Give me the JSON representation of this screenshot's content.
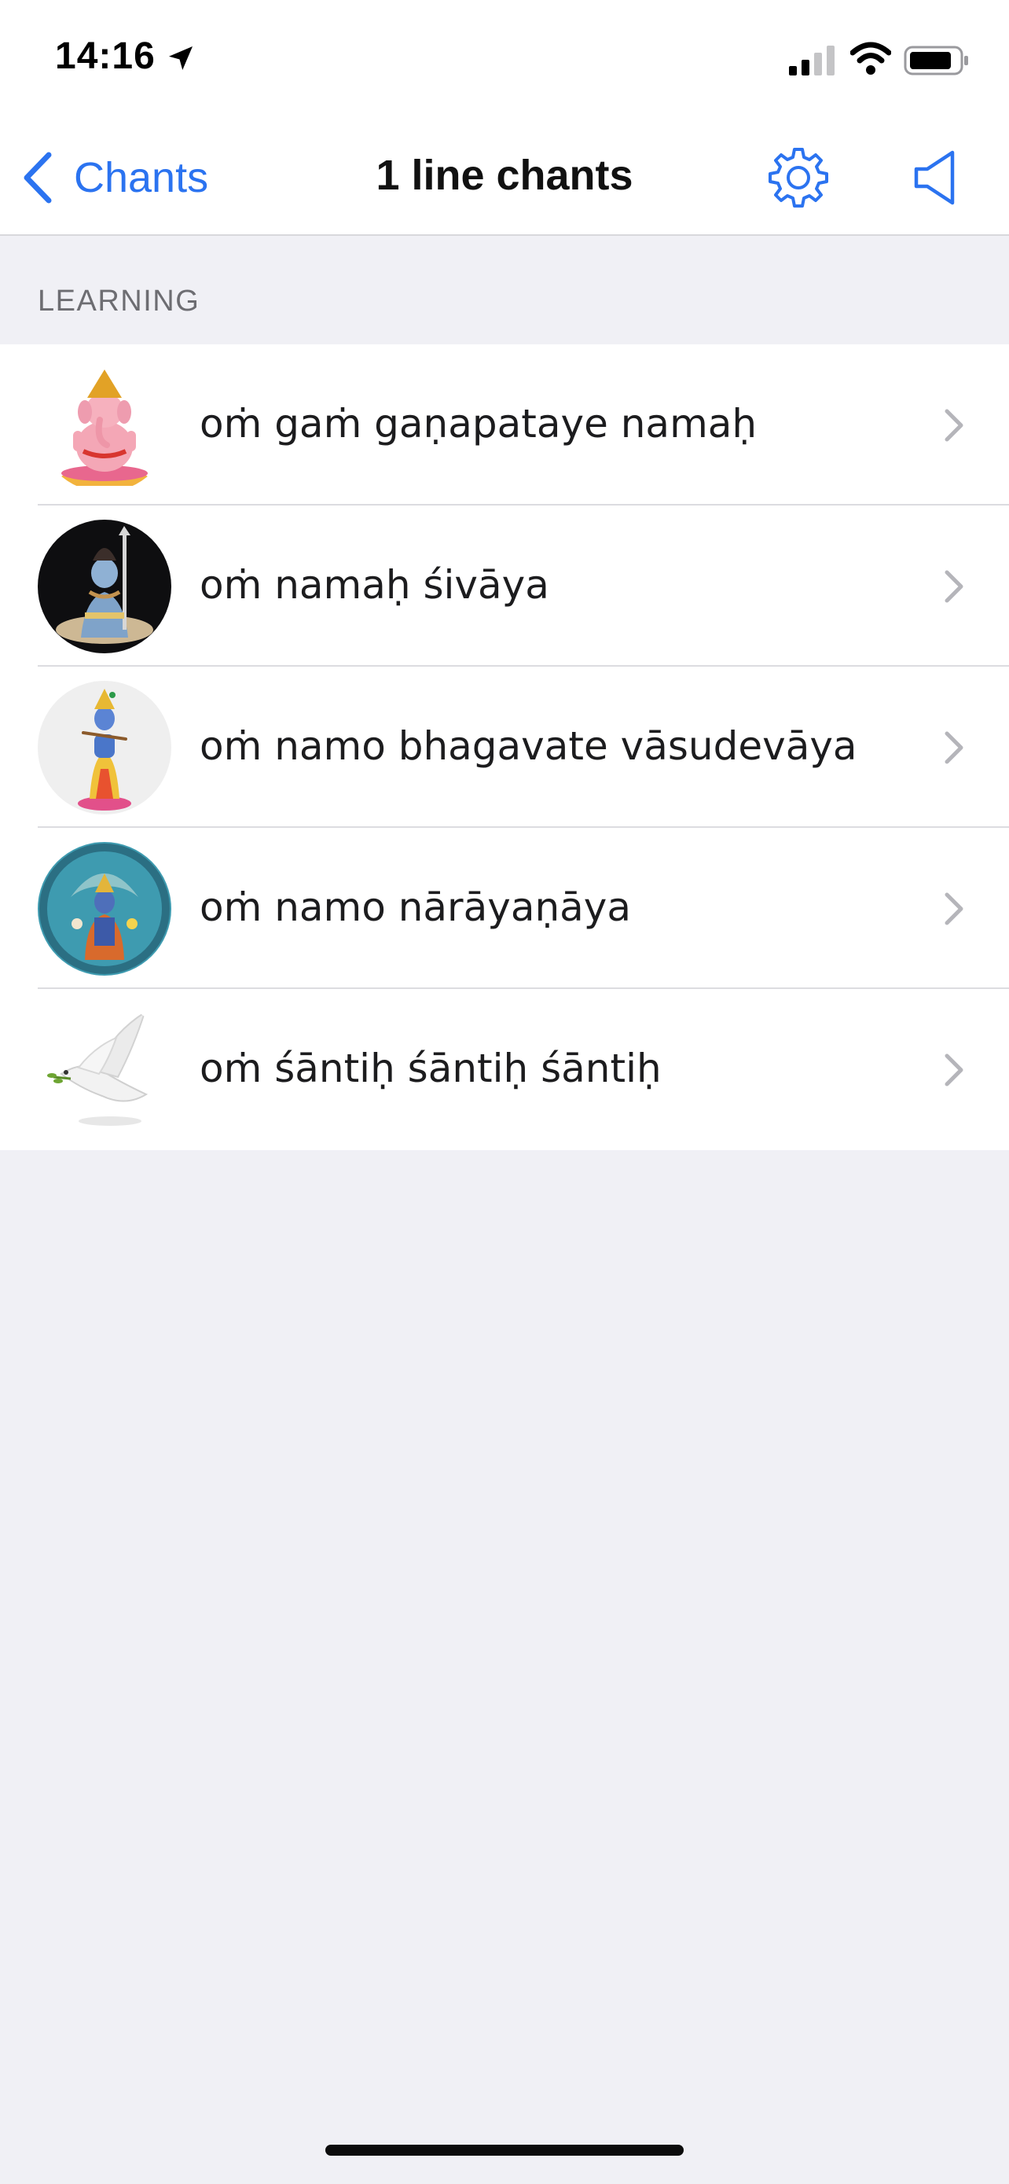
{
  "status_bar": {
    "time": "14:16",
    "icons": [
      "location-arrow-icon",
      "cellular-signal-icon",
      "wifi-icon",
      "battery-icon"
    ]
  },
  "nav": {
    "back_label": "Chants",
    "title": "1 line chants",
    "actions": [
      "settings-gear-icon",
      "speaker-icon"
    ],
    "accent_color": "#2b73f0"
  },
  "section": {
    "header": "LEARNING"
  },
  "items": [
    {
      "label": "oṁ gaṁ gaṇapataye namaḥ",
      "thumbnail": "ganesha-image"
    },
    {
      "label": "oṁ namaḥ śivāya",
      "thumbnail": "shiva-image"
    },
    {
      "label": "oṁ namo bhagavate vāsudevāya",
      "thumbnail": "krishna-image"
    },
    {
      "label": "oṁ namo nārāyaṇāya",
      "thumbnail": "narayana-image"
    },
    {
      "label": "oṁ śāntiḥ śāntiḥ śāntiḥ",
      "thumbnail": "dove-image"
    }
  ]
}
